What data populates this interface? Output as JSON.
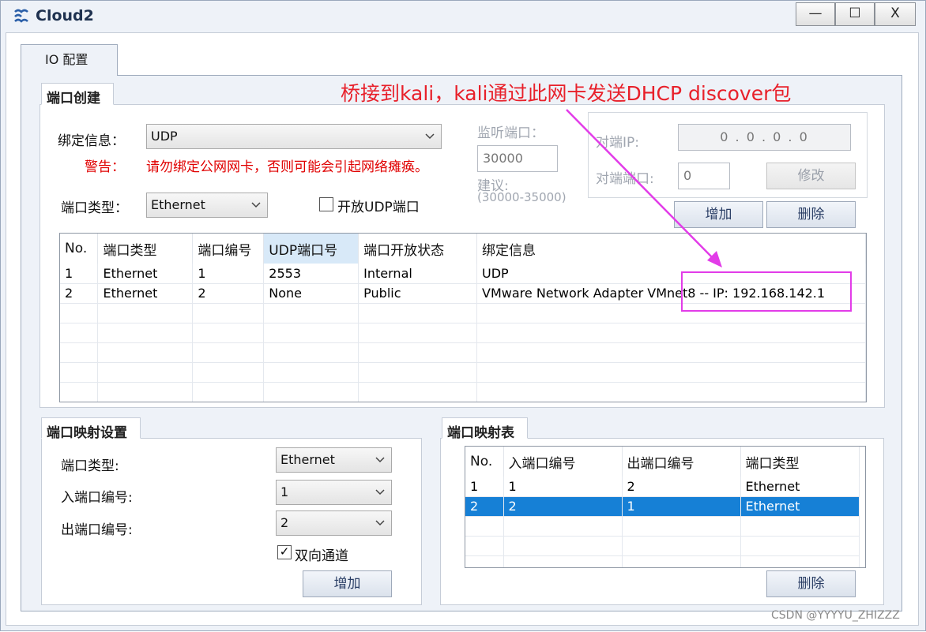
{
  "window": {
    "title": "Cloud2",
    "minimize": "—",
    "maximize": "☐",
    "close": "X"
  },
  "tab": {
    "label": "IO 配置"
  },
  "port_creation": {
    "title": "端口创建",
    "binding_label": "绑定信息：",
    "binding_value": "UDP",
    "warning_label": "警告：",
    "warning_text": "请勿绑定公网网卡，否则可能会引起网络瘫痪。",
    "port_type_label": "端口类型：",
    "port_type_value": "Ethernet",
    "open_udp_label": "开放UDP端口",
    "listen_port_label": "监听端口：",
    "listen_port_value": "30000",
    "suggest_label": "建议:",
    "suggest_range": "(30000-35000)",
    "peer_ip_label": "对端IP:",
    "peer_ip_value": "0 . 0 . 0 . 0",
    "peer_port_label": "对端端口:",
    "peer_port_value": "0",
    "modify_button": "修改",
    "add_button": "增加",
    "delete_button": "删除"
  },
  "port_table": {
    "headers": [
      "No.",
      "端口类型",
      "端口编号",
      "UDP端口号",
      "端口开放状态",
      "绑定信息"
    ],
    "rows": [
      [
        "1",
        "Ethernet",
        "1",
        "2553",
        "Internal",
        "UDP"
      ],
      [
        "2",
        "Ethernet",
        "2",
        "None",
        "Public",
        "VMware Network Adapter VMnet8 -- IP: 192.168.142.1"
      ]
    ]
  },
  "mapping_settings": {
    "title": "端口映射设置",
    "port_type_label": "端口类型:",
    "port_type_value": "Ethernet",
    "in_port_label": "入端口编号:",
    "in_port_value": "1",
    "out_port_label": "出端口编号:",
    "out_port_value": "2",
    "bidirectional_label": "双向通道",
    "add_button": "增加"
  },
  "mapping_table": {
    "title": "端口映射表",
    "headers": [
      "No.",
      "入端口编号",
      "出端口编号",
      "端口类型"
    ],
    "rows": [
      [
        "1",
        "1",
        "2",
        "Ethernet"
      ],
      [
        "2",
        "2",
        "1",
        "Ethernet"
      ]
    ],
    "selected_row": 1,
    "delete_button": "删除"
  },
  "annotation": {
    "text": "桥接到kali，kali通过此网卡发送DHCP discover包"
  },
  "watermark": "CSDN @YYYYU_ZHIZZZ",
  "colors": {
    "annotation": "#e8202a",
    "highlight_box": "#e23ce8",
    "selection": "#1680d6"
  },
  "icons": [
    "app-cloud-icon",
    "chevron-down-icon",
    "checkbox-icon",
    "arrow-icon"
  ]
}
